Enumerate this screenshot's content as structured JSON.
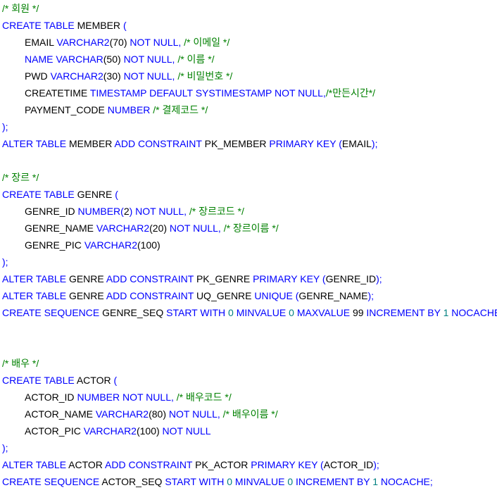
{
  "colors": {
    "keyword": "#0000ff",
    "comment": "#008000",
    "number": "#008080",
    "text": "#000000",
    "background": "#ffffff"
  },
  "lines": [
    {
      "indent": false,
      "tokens": [
        {
          "t": "cm",
          "v": "/* 회원 */"
        }
      ]
    },
    {
      "indent": false,
      "tokens": [
        {
          "t": "kw",
          "v": "CREATE TABLE "
        },
        {
          "t": "tx",
          "v": "MEMBER "
        },
        {
          "t": "kw",
          "v": "("
        }
      ]
    },
    {
      "indent": true,
      "tokens": [
        {
          "t": "tx",
          "v": "EMAIL "
        },
        {
          "t": "kw",
          "v": "VARCHAR2"
        },
        {
          "t": "tx",
          "v": "(70) "
        },
        {
          "t": "kw",
          "v": "NOT NULL, "
        },
        {
          "t": "cm",
          "v": "/* 이메일 */"
        }
      ]
    },
    {
      "indent": true,
      "tokens": [
        {
          "t": "kw",
          "v": "NAME VARCHAR"
        },
        {
          "t": "tx",
          "v": "(50) "
        },
        {
          "t": "kw",
          "v": "NOT NULL, "
        },
        {
          "t": "cm",
          "v": "/* 이름 */"
        }
      ]
    },
    {
      "indent": true,
      "tokens": [
        {
          "t": "tx",
          "v": "PWD "
        },
        {
          "t": "kw",
          "v": "VARCHAR2"
        },
        {
          "t": "tx",
          "v": "(30) "
        },
        {
          "t": "kw",
          "v": "NOT NULL, "
        },
        {
          "t": "cm",
          "v": "/* 비밀번호 */"
        }
      ]
    },
    {
      "indent": true,
      "tokens": [
        {
          "t": "tx",
          "v": "CREATETIME "
        },
        {
          "t": "kw",
          "v": "TIMESTAMP DEFAULT SYSTIMESTAMP NOT NULL,"
        },
        {
          "t": "cm",
          "v": "/*만든시간*/"
        }
      ]
    },
    {
      "indent": true,
      "tokens": [
        {
          "t": "tx",
          "v": "PAYMENT_CODE "
        },
        {
          "t": "kw",
          "v": "NUMBER "
        },
        {
          "t": "cm",
          "v": "/* 결제코드 */"
        }
      ]
    },
    {
      "indent": false,
      "tokens": [
        {
          "t": "kw",
          "v": ");"
        }
      ]
    },
    {
      "indent": false,
      "tokens": [
        {
          "t": "kw",
          "v": "ALTER TABLE "
        },
        {
          "t": "tx",
          "v": "MEMBER "
        },
        {
          "t": "kw",
          "v": "ADD CONSTRAINT "
        },
        {
          "t": "tx",
          "v": "PK_MEMBER "
        },
        {
          "t": "kw",
          "v": "PRIMARY KEY ("
        },
        {
          "t": "tx",
          "v": "EMAIL"
        },
        {
          "t": "kw",
          "v": ");"
        }
      ]
    },
    {
      "indent": false,
      "tokens": []
    },
    {
      "indent": false,
      "tokens": [
        {
          "t": "cm",
          "v": "/* 장르 */"
        }
      ]
    },
    {
      "indent": false,
      "tokens": [
        {
          "t": "kw",
          "v": "CREATE TABLE "
        },
        {
          "t": "tx",
          "v": "GENRE "
        },
        {
          "t": "kw",
          "v": "("
        }
      ]
    },
    {
      "indent": true,
      "tokens": [
        {
          "t": "tx",
          "v": "GENRE_ID "
        },
        {
          "t": "kw",
          "v": "NUMBER("
        },
        {
          "t": "tx",
          "v": "2"
        },
        {
          "t": "kw",
          "v": ") NOT NULL, "
        },
        {
          "t": "cm",
          "v": "/* 장르코드 */"
        }
      ]
    },
    {
      "indent": true,
      "tokens": [
        {
          "t": "tx",
          "v": "GENRE_NAME "
        },
        {
          "t": "kw",
          "v": "VARCHAR2"
        },
        {
          "t": "tx",
          "v": "(20) "
        },
        {
          "t": "kw",
          "v": "NOT NULL, "
        },
        {
          "t": "cm",
          "v": "/* 장르이름 */"
        }
      ]
    },
    {
      "indent": true,
      "tokens": [
        {
          "t": "tx",
          "v": "GENRE_PIC "
        },
        {
          "t": "kw",
          "v": "VARCHAR2"
        },
        {
          "t": "tx",
          "v": "(100)"
        }
      ]
    },
    {
      "indent": false,
      "tokens": [
        {
          "t": "kw",
          "v": ");"
        }
      ]
    },
    {
      "indent": false,
      "tokens": [
        {
          "t": "kw",
          "v": "ALTER TABLE "
        },
        {
          "t": "tx",
          "v": "GENRE "
        },
        {
          "t": "kw",
          "v": "ADD CONSTRAINT "
        },
        {
          "t": "tx",
          "v": "PK_GENRE "
        },
        {
          "t": "kw",
          "v": "PRIMARY KEY ("
        },
        {
          "t": "tx",
          "v": "GENRE_ID"
        },
        {
          "t": "kw",
          "v": ");"
        }
      ]
    },
    {
      "indent": false,
      "tokens": [
        {
          "t": "kw",
          "v": "ALTER TABLE "
        },
        {
          "t": "tx",
          "v": "GENRE "
        },
        {
          "t": "kw",
          "v": "ADD CONSTRAINT "
        },
        {
          "t": "tx",
          "v": "UQ_GENRE "
        },
        {
          "t": "kw",
          "v": "UNIQUE ("
        },
        {
          "t": "tx",
          "v": "GENRE_NAME"
        },
        {
          "t": "kw",
          "v": ");"
        }
      ]
    },
    {
      "indent": false,
      "tokens": [
        {
          "t": "kw",
          "v": "CREATE SEQUENCE "
        },
        {
          "t": "tx",
          "v": "GENRE_SEQ "
        },
        {
          "t": "kw",
          "v": "START WITH "
        },
        {
          "t": "nm",
          "v": "0 "
        },
        {
          "t": "kw",
          "v": "MINVALUE "
        },
        {
          "t": "nm",
          "v": "0 "
        },
        {
          "t": "kw",
          "v": "MAXVALUE "
        },
        {
          "t": "tx",
          "v": "99 "
        },
        {
          "t": "kw",
          "v": "INCREMENT BY "
        },
        {
          "t": "nm",
          "v": "1 "
        },
        {
          "t": "kw",
          "v": "NOCACHE;"
        }
      ]
    },
    {
      "indent": false,
      "tokens": []
    },
    {
      "indent": false,
      "tokens": []
    },
    {
      "indent": false,
      "tokens": [
        {
          "t": "cm",
          "v": "/* 배우 */"
        }
      ]
    },
    {
      "indent": false,
      "tokens": [
        {
          "t": "kw",
          "v": "CREATE TABLE "
        },
        {
          "t": "tx",
          "v": "ACTOR "
        },
        {
          "t": "kw",
          "v": "("
        }
      ]
    },
    {
      "indent": true,
      "tokens": [
        {
          "t": "tx",
          "v": "ACTOR_ID "
        },
        {
          "t": "kw",
          "v": "NUMBER NOT NULL, "
        },
        {
          "t": "cm",
          "v": "/* 배우코드 */"
        }
      ]
    },
    {
      "indent": true,
      "tokens": [
        {
          "t": "tx",
          "v": "ACTOR_NAME "
        },
        {
          "t": "kw",
          "v": "VARCHAR2"
        },
        {
          "t": "tx",
          "v": "(80) "
        },
        {
          "t": "kw",
          "v": "NOT NULL, "
        },
        {
          "t": "cm",
          "v": "/* 배우이름 */"
        }
      ]
    },
    {
      "indent": true,
      "tokens": [
        {
          "t": "tx",
          "v": "ACTOR_PIC "
        },
        {
          "t": "kw",
          "v": "VARCHAR2"
        },
        {
          "t": "tx",
          "v": "(100) "
        },
        {
          "t": "kw",
          "v": "NOT NULL"
        }
      ]
    },
    {
      "indent": false,
      "tokens": [
        {
          "t": "kw",
          "v": ");"
        }
      ]
    },
    {
      "indent": false,
      "tokens": [
        {
          "t": "kw",
          "v": "ALTER TABLE "
        },
        {
          "t": "tx",
          "v": "ACTOR "
        },
        {
          "t": "kw",
          "v": "ADD CONSTRAINT "
        },
        {
          "t": "tx",
          "v": "PK_ACTOR "
        },
        {
          "t": "kw",
          "v": "PRIMARY KEY ("
        },
        {
          "t": "tx",
          "v": "ACTOR_ID"
        },
        {
          "t": "kw",
          "v": ");"
        }
      ]
    },
    {
      "indent": false,
      "tokens": [
        {
          "t": "kw",
          "v": "CREATE SEQUENCE "
        },
        {
          "t": "tx",
          "v": "ACTOR_SEQ "
        },
        {
          "t": "kw",
          "v": "START WITH "
        },
        {
          "t": "nm",
          "v": "0 "
        },
        {
          "t": "kw",
          "v": "MINVALUE "
        },
        {
          "t": "nm",
          "v": "0 "
        },
        {
          "t": "kw",
          "v": "INCREMENT BY "
        },
        {
          "t": "nm",
          "v": "1 "
        },
        {
          "t": "kw",
          "v": "NOCACHE;"
        }
      ]
    }
  ]
}
